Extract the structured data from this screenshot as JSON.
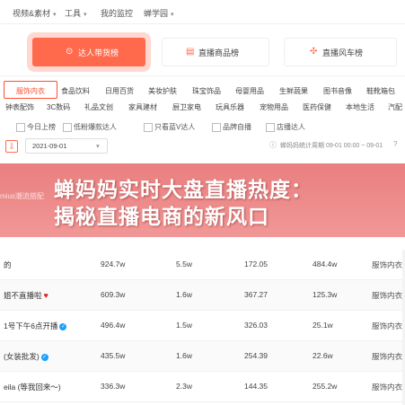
{
  "topnav": {
    "items": [
      {
        "label": "视频&素材",
        "caret": true
      },
      {
        "label": "工具",
        "caret": true
      },
      {
        "label": "我的监控",
        "caret": false
      },
      {
        "label": "蝉学园",
        "caret": true
      }
    ]
  },
  "main_tabs": [
    {
      "label": "达人带货榜",
      "icon": "location-pin-icon",
      "active": true
    },
    {
      "label": "直播商品榜",
      "icon": "list-icon",
      "active": false
    },
    {
      "label": "直播风车榜",
      "icon": "windmill-icon",
      "active": false
    }
  ],
  "categories_row1": [
    "服饰内衣",
    "食品饮料",
    "日用百货",
    "美妆护肤",
    "珠宝饰品",
    "母婴用品",
    "生鲜蔬果",
    "图书音像",
    "鞋靴箱包"
  ],
  "categories_row2": [
    "钟表配饰",
    "3C数码",
    "礼品文创",
    "家具建材",
    "厨卫家电",
    "玩具乐器",
    "宠物用品",
    "医药保健",
    "本地生活",
    "汽配"
  ],
  "filters": {
    "checkboxes": [
      "今日上榜",
      "低粉爆款达人",
      "只看蓝V达人",
      "品牌自播",
      "店播达人"
    ],
    "date": "2021-09-01",
    "right_text": "蝉妈妈统计周期 09-01 00:00 ~ 09-01"
  },
  "banner": {
    "line1": "蝉妈妈实时大盘直播热度：",
    "line2": "揭秘直播电商的新风口",
    "peek": "mius潮流搭配"
  },
  "rows": [
    {
      "name": "的",
      "badge": "",
      "c1": "924.7w",
      "c2": "5.5w",
      "c3": "172.05",
      "c4": "484.4w",
      "c5": "服饰内衣"
    },
    {
      "name": "姐不直播啦",
      "badge": "heart",
      "c1": "609.3w",
      "c2": "1.6w",
      "c3": "367.27",
      "c4": "125.3w",
      "c5": "服饰内衣"
    },
    {
      "name": "1号下午6点开播",
      "badge": "blue",
      "c1": "496.4w",
      "c2": "1.5w",
      "c3": "326.03",
      "c4": "25.1w",
      "c5": "服饰内衣"
    },
    {
      "name": "(女装批发)",
      "badge": "blue",
      "c1": "435.5w",
      "c2": "1.6w",
      "c3": "254.39",
      "c4": "22.6w",
      "c5": "服饰内衣"
    },
    {
      "name": "eila (等我回来～)",
      "badge": "",
      "c1": "336.3w",
      "c2": "2.3w",
      "c3": "144.35",
      "c4": "255.2w",
      "c5": "服饰内衣"
    }
  ]
}
